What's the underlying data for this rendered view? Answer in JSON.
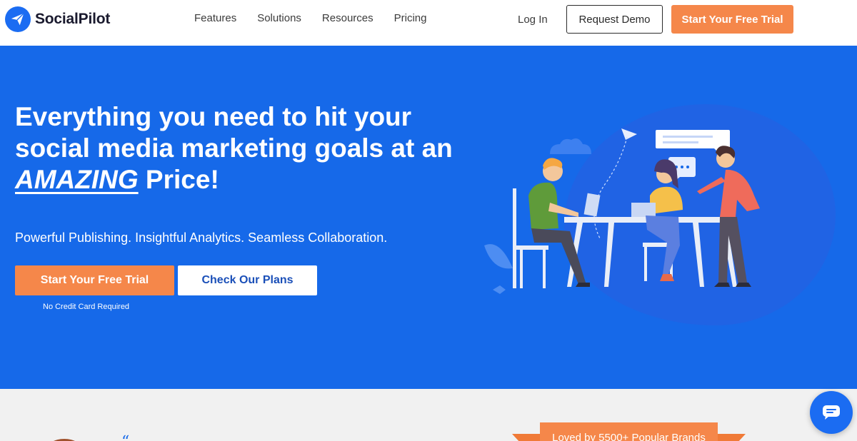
{
  "header": {
    "brand": "SocialPilot",
    "nav": [
      {
        "label": "Features"
      },
      {
        "label": "Solutions"
      },
      {
        "label": "Resources"
      },
      {
        "label": "Pricing"
      }
    ],
    "login_label": "Log In",
    "demo_label": "Request Demo",
    "trial_label": "Start Your Free Trial"
  },
  "hero": {
    "headline_line1": "Everything you need to hit your",
    "headline_line2": "social media marketing goals at an",
    "headline_emphasis": "AMAZING",
    "headline_tail": " Price!",
    "subheadline": "Powerful Publishing. Insightful Analytics. Seamless Collaboration.",
    "primary_cta": "Start Your Free Trial",
    "secondary_cta": "Check Our Plans",
    "cta_note": "No Credit Card Required"
  },
  "social_proof": {
    "ribbon_text": "Loved by 5500+ Popular Brands"
  },
  "colors": {
    "brand_blue": "#1669e9",
    "accent_orange": "#f5874a"
  },
  "icons": {
    "logo": "paper-plane-icon",
    "chat": "chat-icon"
  }
}
